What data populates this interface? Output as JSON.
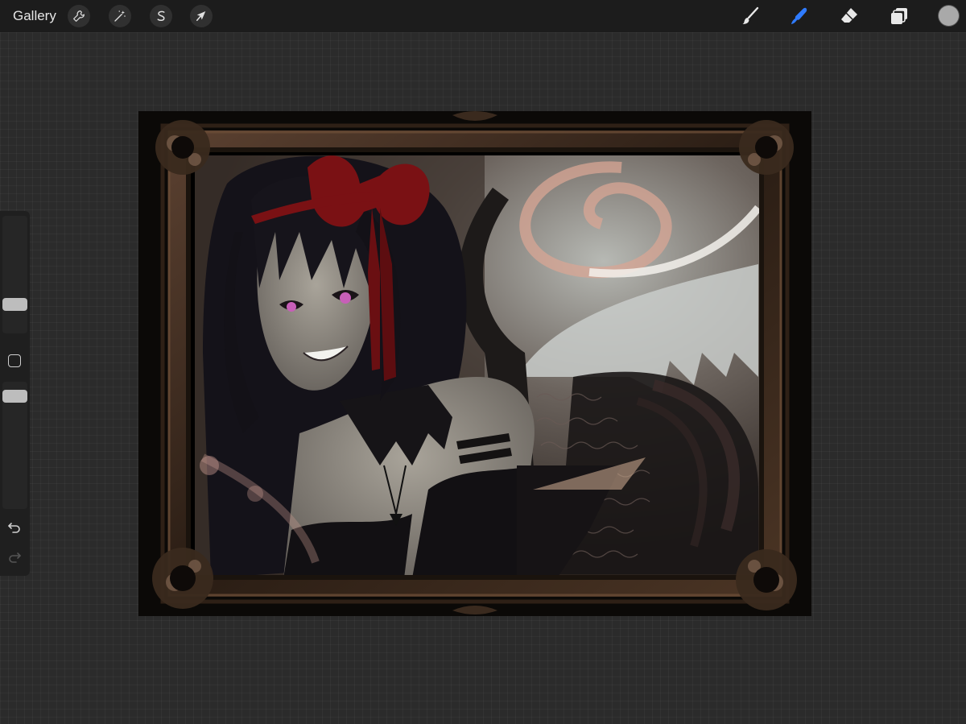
{
  "topbar": {
    "gallery_label": "Gallery",
    "left_tools": [
      {
        "icon": "wrench-icon",
        "name": "actions-button"
      },
      {
        "icon": "magic-wand-icon",
        "name": "adjustments-button"
      },
      {
        "icon": "selection-s-icon",
        "name": "selection-button"
      },
      {
        "icon": "arrow-cursor-icon",
        "name": "transform-button"
      }
    ],
    "right_tools": [
      {
        "icon": "brush-icon",
        "name": "paint-tool"
      },
      {
        "icon": "smudge-finger-icon",
        "name": "smudge-tool",
        "active": true
      },
      {
        "icon": "eraser-icon",
        "name": "eraser-tool"
      },
      {
        "icon": "layers-icon",
        "name": "layers-button"
      }
    ],
    "current_color": "#a9a9a9",
    "active_color": "#2f7bff"
  },
  "sidebar": {
    "brush_size_level": 0.75,
    "opacity_level": 0.85,
    "modify_icon": "square-icon",
    "undo_icon": "undo-arrow-icon",
    "redo_icon": "redo-arrow-icon"
  },
  "canvas": {
    "artwork": "artwork-illustration",
    "frame_color": "#3a2a1e"
  }
}
